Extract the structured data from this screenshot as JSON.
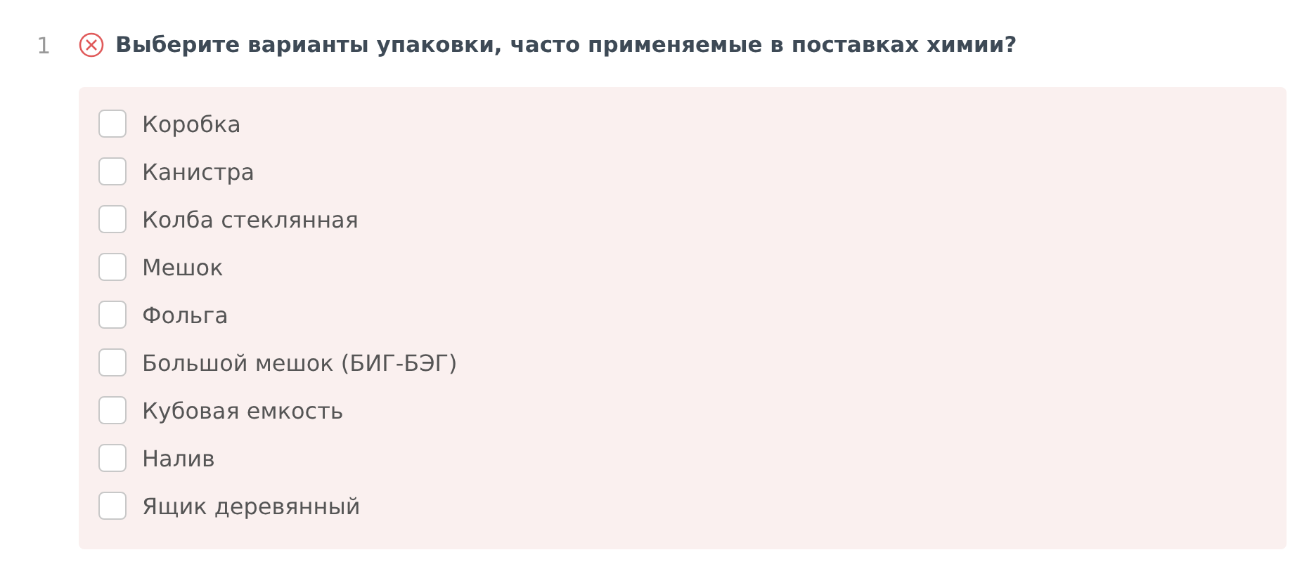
{
  "question": {
    "number": "1",
    "correct": false,
    "text": "Выберите варианты упаковки, часто применяемые в поставках химии?",
    "options": [
      {
        "label": "Коробка",
        "checked": false
      },
      {
        "label": "Канистра",
        "checked": false
      },
      {
        "label": "Колба стеклянная",
        "checked": false
      },
      {
        "label": "Мешок",
        "checked": false
      },
      {
        "label": "Фольга",
        "checked": false
      },
      {
        "label": "Большой мешок (БИГ-БЭГ)",
        "checked": false
      },
      {
        "label": "Кубовая емкость",
        "checked": false
      },
      {
        "label": "Налив",
        "checked": false
      },
      {
        "label": "Ящик деревянный",
        "checked": false
      }
    ]
  }
}
